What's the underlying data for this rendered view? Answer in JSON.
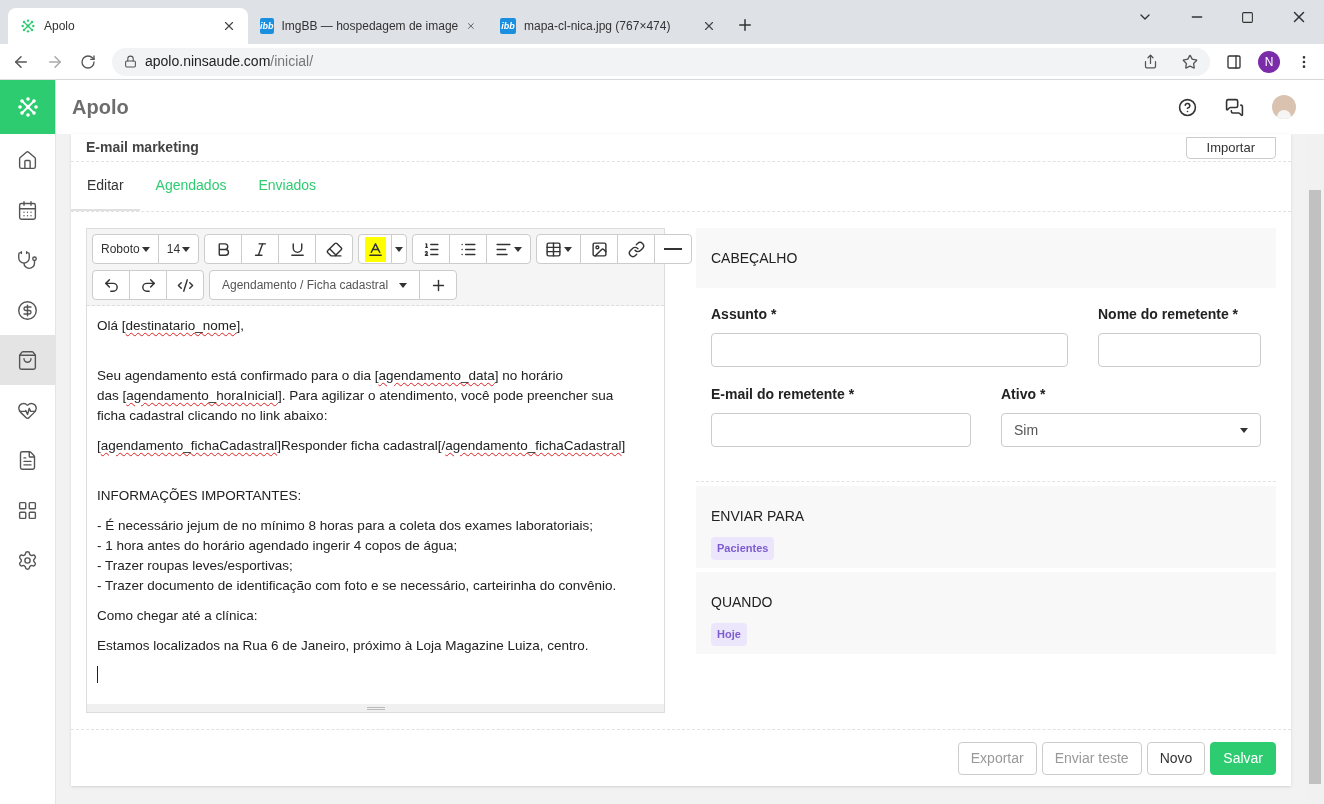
{
  "browser": {
    "tabs": [
      {
        "title": "Apolo",
        "selected": true,
        "kind": "logo"
      },
      {
        "title": "ImgBB — hospedagem de image",
        "selected": false,
        "kind": "label",
        "favicon_label": "ibb"
      },
      {
        "title": "mapa-cl-nica.jpg (767×474)",
        "selected": false,
        "kind": "label",
        "favicon_label": "ibb"
      }
    ],
    "url": {
      "domain": "apolo.ninsaude.com",
      "path": "/inicial/"
    },
    "profile_initial": "N"
  },
  "app": {
    "brand": "Apolo",
    "sidebar": [
      {
        "kind": "home",
        "selected": false
      },
      {
        "kind": "calendar",
        "selected": false
      },
      {
        "kind": "stethoscope",
        "selected": false
      },
      {
        "kind": "money",
        "selected": false
      },
      {
        "kind": "bag",
        "selected": true
      },
      {
        "kind": "heart",
        "selected": false
      },
      {
        "kind": "document",
        "selected": false
      },
      {
        "kind": "grid",
        "selected": false
      },
      {
        "kind": "settings",
        "selected": false
      }
    ]
  },
  "card": {
    "title": "E-mail marketing",
    "import_button": "Importar",
    "tabs": [
      {
        "label": "Editar",
        "selected": true
      },
      {
        "label": "Agendados",
        "selected": false
      },
      {
        "label": "Enviados",
        "selected": false
      }
    ],
    "editor": {
      "font": "Roboto",
      "size": "14",
      "insert_select": "Agendamento / Ficha cadastral",
      "paragraphs": [
        {
          "blank_after": true,
          "lines": [
            [
              {
                "text": "Olá ["
              },
              {
                "text": "destinatario_nome",
                "flagged": true
              },
              {
                "text": "],"
              }
            ]
          ]
        },
        {
          "blank_after": false,
          "lines": [
            [
              {
                "text": "Seu agendamento está confirmado para o dia ["
              },
              {
                "text": "agendamento_data",
                "flagged": true
              },
              {
                "text": "] no horário"
              }
            ],
            [
              {
                "text": "das ["
              },
              {
                "text": "agendamento_horaInicial",
                "flagged": true
              },
              {
                "text": "]. Para agilizar o atendimento, você pode preencher sua"
              }
            ],
            [
              {
                "text": "ficha cadastral clicando no link abaixo:"
              }
            ]
          ]
        },
        {
          "blank_after": true,
          "lines": [
            [
              {
                "text": "["
              },
              {
                "text": "agendamento_fichaCadastral",
                "flagged": true
              },
              {
                "text": "]Responder ficha cadastral[/"
              },
              {
                "text": "agendamento_fichaCadastral",
                "flagged": true
              },
              {
                "text": "]"
              }
            ]
          ]
        },
        {
          "blank_after": false,
          "lines": [
            [
              {
                "text": "INFORMAÇÕES IMPORTANTES:"
              }
            ]
          ]
        },
        {
          "blank_after": false,
          "lines": [
            [
              {
                "text": "- É necessário jejum de no mínimo 8 horas para a coleta dos exames laboratoriais;"
              }
            ],
            [
              {
                "text": "- 1 hora antes do horário agendado ingerir 4 copos de água;"
              }
            ],
            [
              {
                "text": "- Trazer roupas leves/esportivas;"
              }
            ],
            [
              {
                "text": "- Trazer documento de identificação com foto e se necessário, carteirinha do convênio."
              }
            ]
          ]
        },
        {
          "blank_after": false,
          "lines": [
            [
              {
                "text": "Como chegar até a clínica:"
              }
            ]
          ]
        },
        {
          "blank_after": false,
          "lines": [
            [
              {
                "text": "Estamos localizados na Rua 6 de Janeiro, próximo à Loja Magazine Luiza, centro."
              }
            ]
          ]
        }
      ]
    },
    "header_section": {
      "title": "CABEÇALHO",
      "fields": [
        {
          "label": "Assunto *",
          "kind": "text"
        },
        {
          "label": "Nome do remetente *",
          "kind": "text"
        },
        {
          "label": "E-mail do remetente *",
          "kind": "text"
        },
        {
          "label": "Ativo *",
          "kind": "select",
          "value": "Sim"
        }
      ]
    },
    "sections": [
      {
        "title": "ENVIAR PARA",
        "tag": "Pacientes"
      },
      {
        "title": "QUANDO",
        "tag": "Hoje"
      }
    ],
    "buttons": [
      {
        "label": "Exportar",
        "kind": "default",
        "disabled": true
      },
      {
        "label": "Enviar teste",
        "kind": "default",
        "disabled": true
      },
      {
        "label": "Novo",
        "kind": "default",
        "disabled": false
      },
      {
        "label": "Salvar",
        "kind": "primary",
        "disabled": false
      }
    ]
  }
}
